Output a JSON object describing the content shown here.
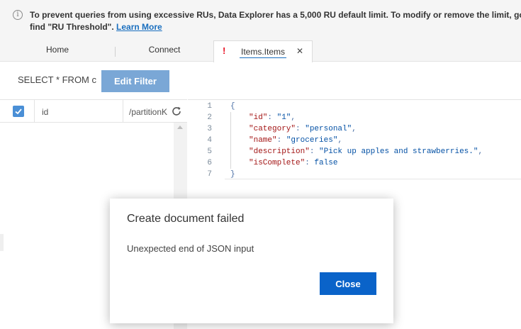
{
  "banner": {
    "line1": "To prevent queries from using excessive RUs, Data Explorer has a 5,000 RU default limit. To modify or remove the limit, go t",
    "line2_text": "find \"RU Threshold\". ",
    "line2_link": "Learn More"
  },
  "tabs": {
    "home": "Home",
    "connect": "Connect",
    "items": "Items.Items",
    "warning_glyph": "!",
    "close_glyph": "✕"
  },
  "query": {
    "text": "SELECT * FROM c",
    "edit_filter_label": "Edit Filter"
  },
  "documents": {
    "columns": [
      "id",
      "/partitionK"
    ]
  },
  "editor": {
    "line_numbers": [
      "1",
      "2",
      "3",
      "4",
      "5",
      "6",
      "7"
    ],
    "lines": [
      {
        "open": "{"
      },
      {
        "key": "\"id\"",
        "value": "\"1\"",
        "trail": ","
      },
      {
        "key": "\"category\"",
        "value": "\"personal\"",
        "trail": ","
      },
      {
        "key": "\"name\"",
        "value": "\"groceries\"",
        "trail": ","
      },
      {
        "key": "\"description\"",
        "value": "\"Pick up apples and strawberries.\"",
        "trail": ","
      },
      {
        "key": "\"isComplete\"",
        "value": "false",
        "trail": ""
      },
      {
        "close": "}"
      }
    ]
  },
  "dialog": {
    "title": "Create document failed",
    "message": "Unexpected end of JSON input",
    "close_label": "Close"
  },
  "colors": {
    "accent": "#0a63c9",
    "edit_filter": "#7aa7d6",
    "warning": "#e81123"
  }
}
